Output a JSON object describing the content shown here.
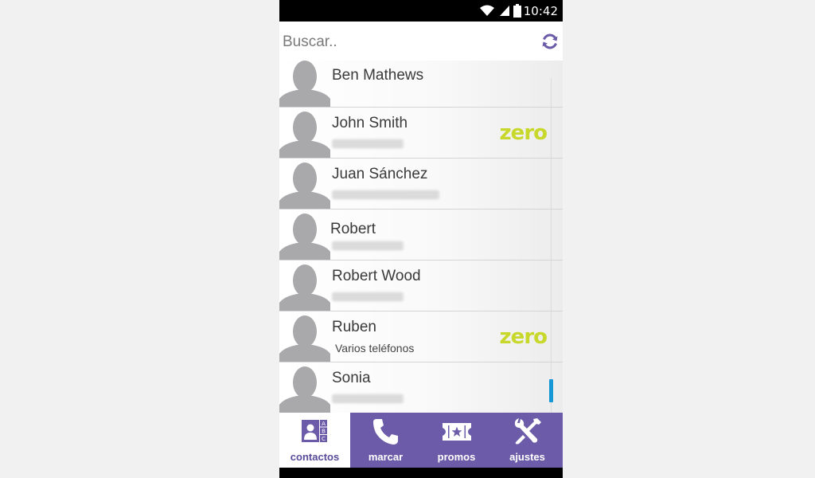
{
  "status_bar": {
    "time": "10:42"
  },
  "search": {
    "placeholder": "Buscar.."
  },
  "contacts": [
    {
      "name": "Ben Mathews",
      "subtitle": "",
      "badge": ""
    },
    {
      "name": "John Smith",
      "subtitle": "",
      "badge": "zero"
    },
    {
      "name": "Juan Sánchez",
      "subtitle": "",
      "badge": ""
    },
    {
      "name": "Robert",
      "subtitle": "",
      "badge": ""
    },
    {
      "name": "Robert Wood",
      "subtitle": "",
      "badge": ""
    },
    {
      "name": "Ruben",
      "subtitle": "Varios teléfonos",
      "badge": "zero"
    },
    {
      "name": "Sonia",
      "subtitle": "",
      "badge": ""
    }
  ],
  "tabs": [
    {
      "label": "contactos",
      "icon": "contacts-abc-icon",
      "active": true
    },
    {
      "label": "marcar",
      "icon": "phone-icon",
      "active": false
    },
    {
      "label": "promos",
      "icon": "ticket-star-icon",
      "active": false
    },
    {
      "label": "ajustes",
      "icon": "tools-icon",
      "active": false
    }
  ],
  "colors": {
    "accent": "#6b5ba8",
    "badge": "#c8d82a",
    "scrollbar": "#1697d6",
    "avatar": "#a9a9ab"
  }
}
